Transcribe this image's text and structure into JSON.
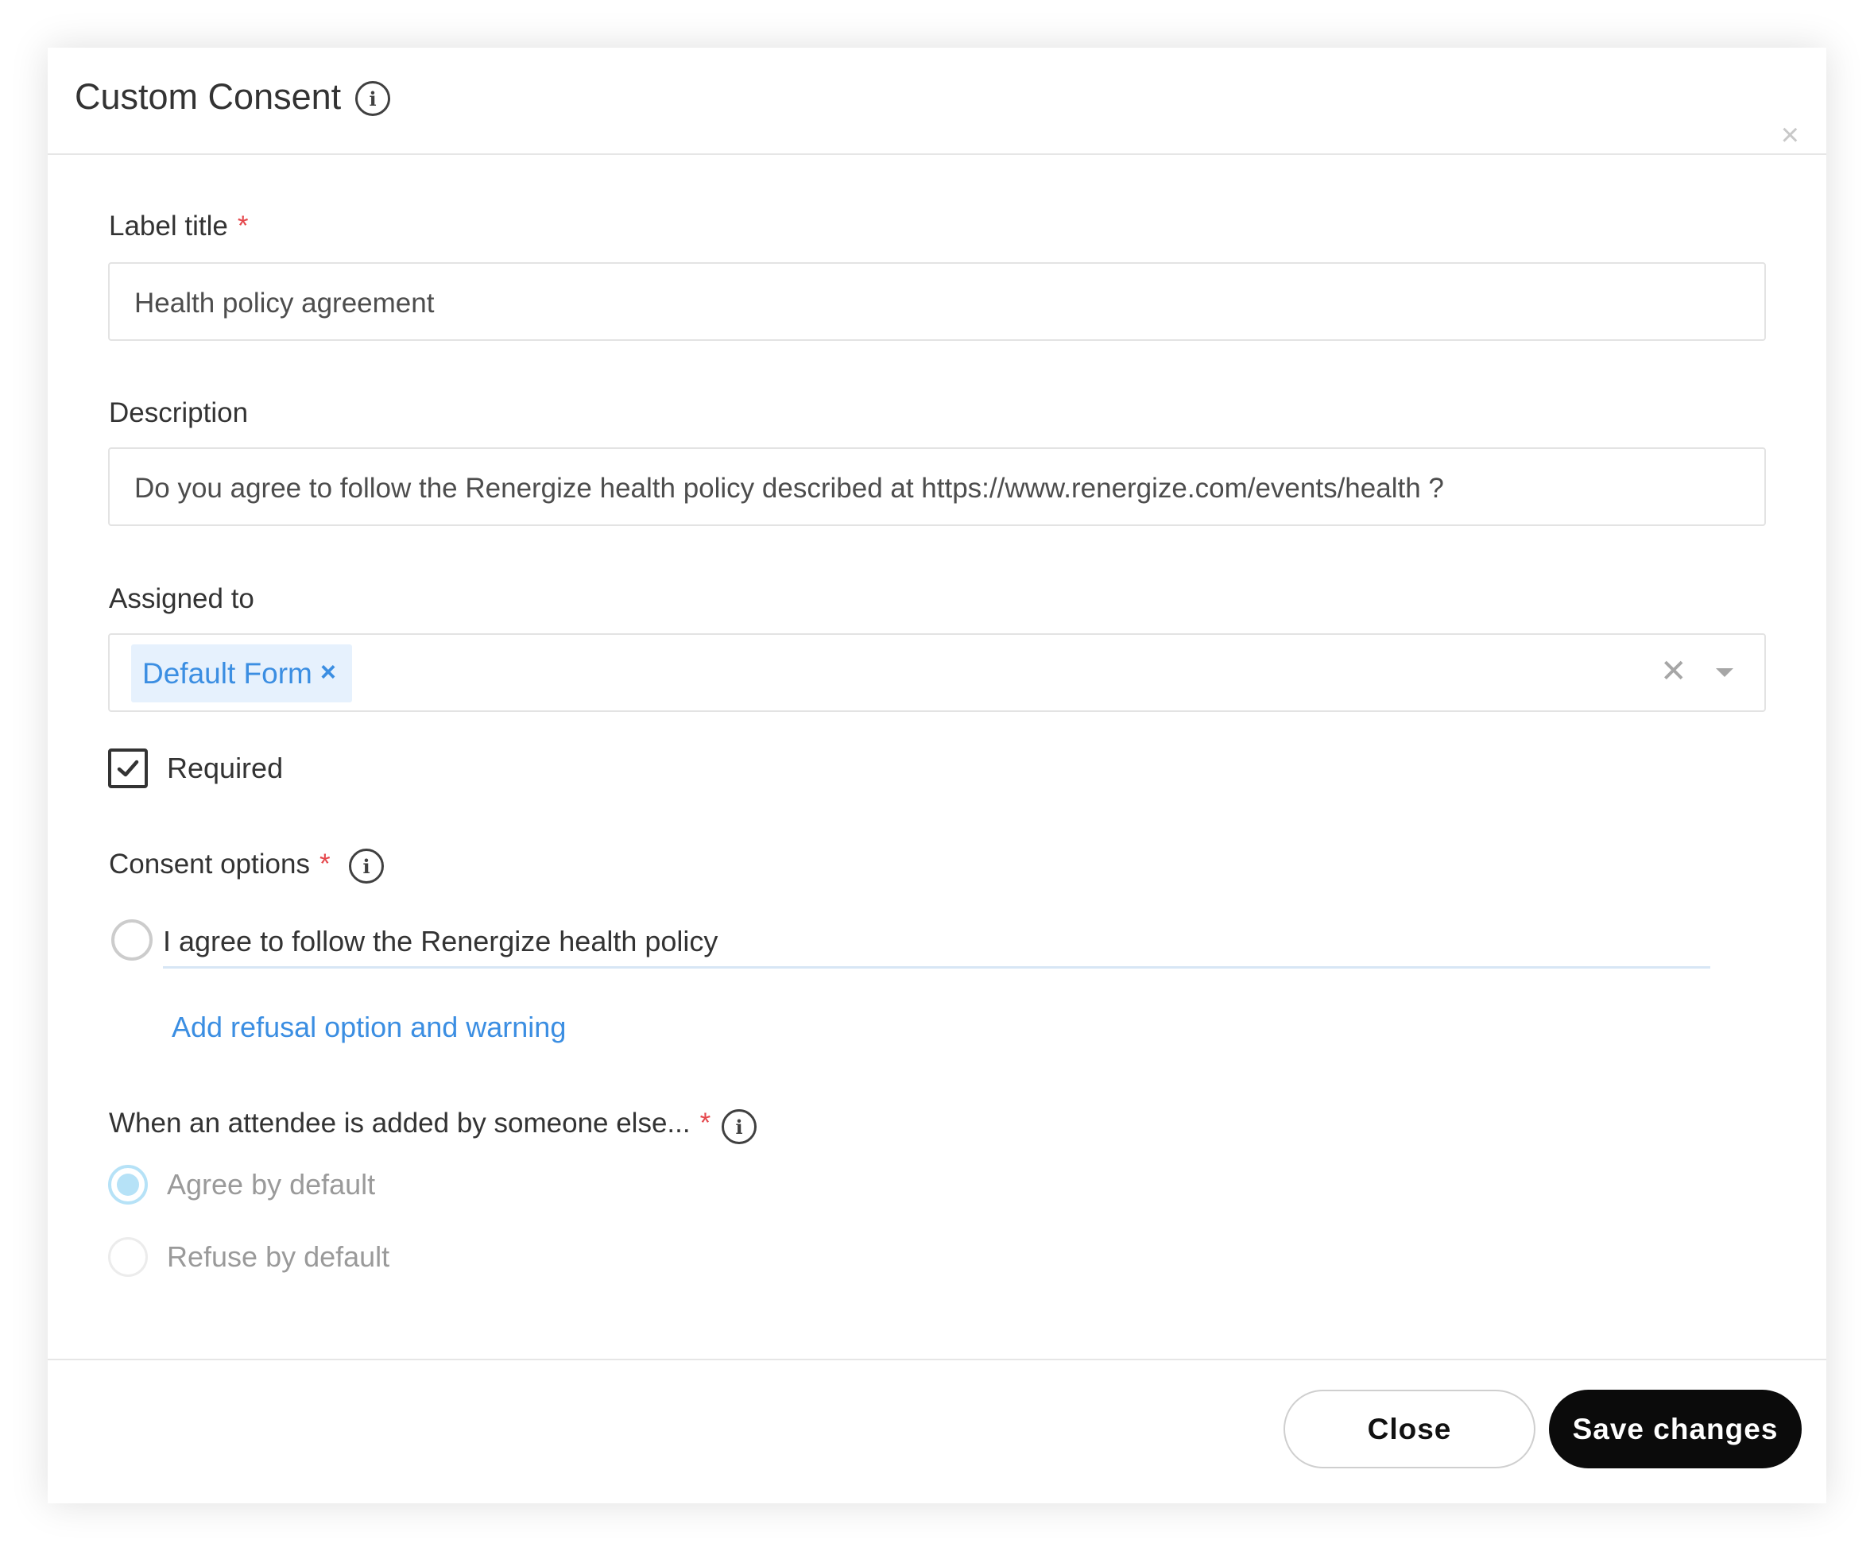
{
  "modal": {
    "title": "Custom Consent",
    "close_glyph": "×"
  },
  "form": {
    "label_title": {
      "label": "Label title",
      "required_mark": "*",
      "value": "Health policy agreement"
    },
    "description": {
      "label": "Description",
      "value": "Do you agree to follow the Renergize health policy described at https://www.renergize.com/events/health ?"
    },
    "assigned_to": {
      "label": "Assigned to",
      "chips": [
        {
          "label": "Default Form",
          "remove_glyph": "×"
        }
      ],
      "clear_glyph": "✕"
    },
    "required_checkbox": {
      "label": "Required",
      "checked": true
    },
    "consent_options": {
      "label": "Consent options",
      "required_mark": "*",
      "options": [
        {
          "text": "I agree to follow the Renergize health policy"
        }
      ],
      "add_link": "Add refusal option and warning"
    },
    "added_by_other": {
      "label": "When an attendee is added by someone else...",
      "required_mark": "*",
      "choices": [
        {
          "label": "Agree by default",
          "selected": true
        },
        {
          "label": "Refuse by default",
          "selected": false
        }
      ]
    }
  },
  "footer": {
    "close_label": "Close",
    "save_label": "Save changes"
  },
  "icons": {
    "info": "i"
  },
  "colors": {
    "accent_blue": "#3b8ee2",
    "required_red": "#e5484d",
    "primary_button": "#0b0b0b"
  }
}
